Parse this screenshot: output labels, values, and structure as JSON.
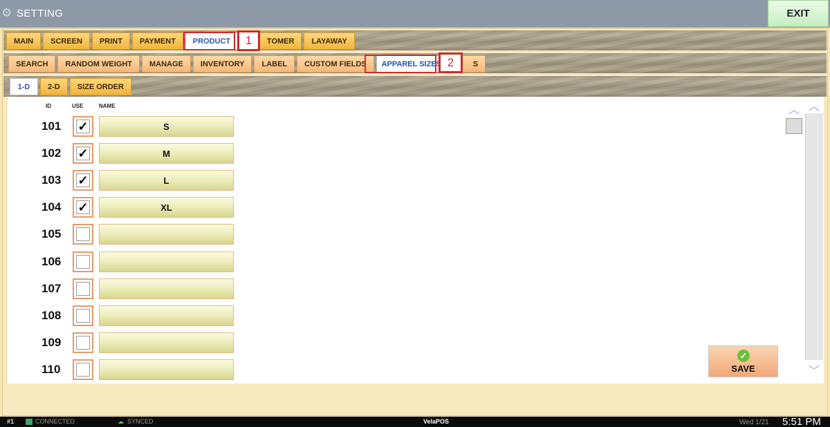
{
  "titlebar": {
    "title": "SETTING",
    "exit_label": "EXIT"
  },
  "main_tabs": [
    {
      "label": "MAIN"
    },
    {
      "label": "SCREEN"
    },
    {
      "label": "PRINT"
    },
    {
      "label": "PAYMENT"
    },
    {
      "label": "PRODUCT",
      "active": true
    },
    {
      "label": "TOMER"
    },
    {
      "label": "LAYAWAY"
    }
  ],
  "sub_tabs": [
    {
      "label": "SEARCH"
    },
    {
      "label": "RANDOM WEIGHT"
    },
    {
      "label": "MANAGE"
    },
    {
      "label": "INVENTORY"
    },
    {
      "label": "LABEL"
    },
    {
      "label": "CUSTOM FIELDS"
    },
    {
      "label": "APPAREL SIZES",
      "active": true
    },
    {
      "label": "S"
    }
  ],
  "size_tabs": [
    {
      "label": "1-D",
      "active": true
    },
    {
      "label": "2-D"
    },
    {
      "label": "SIZE ORDER"
    }
  ],
  "callouts": {
    "one": "1",
    "two": "2"
  },
  "columns": {
    "id": "ID",
    "use": "USE",
    "name": "NAME"
  },
  "rows": [
    {
      "id": "101",
      "use": true,
      "name": "S"
    },
    {
      "id": "102",
      "use": true,
      "name": "M"
    },
    {
      "id": "103",
      "use": true,
      "name": "L"
    },
    {
      "id": "104",
      "use": true,
      "name": "XL"
    },
    {
      "id": "105",
      "use": false,
      "name": ""
    },
    {
      "id": "106",
      "use": false,
      "name": ""
    },
    {
      "id": "107",
      "use": false,
      "name": ""
    },
    {
      "id": "108",
      "use": false,
      "name": ""
    },
    {
      "id": "109",
      "use": false,
      "name": ""
    },
    {
      "id": "110",
      "use": false,
      "name": ""
    }
  ],
  "checkmark": "✓",
  "save_label": "SAVE",
  "statusbar": {
    "terminal": "#1",
    "connection": "CONNECTED",
    "sync": "SYNCED",
    "app": "VelaPOS",
    "date": "Wed 1/21",
    "time": "5:51 PM"
  },
  "colors": {
    "accent_blue": "#2a5aa8",
    "callout_red": "#cc2b2b",
    "tab_orange": "#f2b53c"
  }
}
